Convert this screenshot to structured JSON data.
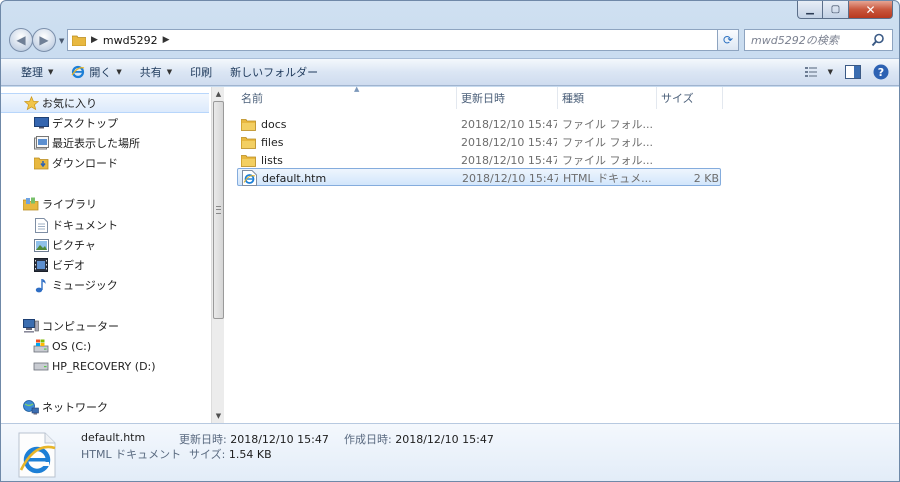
{
  "breadcrumb": {
    "folder": "mwd5292"
  },
  "search": {
    "placeholder": "mwd5292の検索"
  },
  "toolbar": {
    "organize": "整理",
    "open": "開く",
    "share": "共有",
    "print": "印刷",
    "new_folder": "新しいフォルダー"
  },
  "navpane": {
    "favorites": "お気に入り",
    "favorites_items": [
      "デスクトップ",
      "最近表示した場所",
      "ダウンロード"
    ],
    "libraries": "ライブラリ",
    "libraries_items": [
      "ドキュメント",
      "ピクチャ",
      "ビデオ",
      "ミュージック"
    ],
    "computer": "コンピューター",
    "computer_items": [
      "OS (C:)",
      "HP_RECOVERY (D:)"
    ],
    "network": "ネットワーク"
  },
  "columns": {
    "name": "名前",
    "date": "更新日時",
    "type": "種類",
    "size": "サイズ"
  },
  "files": [
    {
      "name": "docs",
      "date": "2018/12/10 15:47",
      "type": "ファイル フォル...",
      "size": "",
      "icon": "folder-icon"
    },
    {
      "name": "files",
      "date": "2018/12/10 15:47",
      "type": "ファイル フォル...",
      "size": "",
      "icon": "folder-icon"
    },
    {
      "name": "lists",
      "date": "2018/12/10 15:47",
      "type": "ファイル フォル...",
      "size": "",
      "icon": "folder-icon"
    },
    {
      "name": "default.htm",
      "date": "2018/12/10 15:47",
      "type": "HTML ドキュメ...",
      "size": "2 KB",
      "icon": "ie-document-icon",
      "selected": true
    }
  ],
  "details": {
    "filename": "default.htm",
    "filetype": "HTML ドキュメント",
    "modified_label": "更新日時:",
    "modified_value": "2018/12/10 15:47",
    "created_label": "作成日時:",
    "created_value": "2018/12/10 15:47",
    "size_label": "サイズ:",
    "size_value": "1.54 KB"
  },
  "colors": {
    "selection_border": "#84acdd",
    "selection_fill": "#d2e6fb",
    "folder": "#e8b840",
    "ie_blue": "#1d7fd6"
  }
}
